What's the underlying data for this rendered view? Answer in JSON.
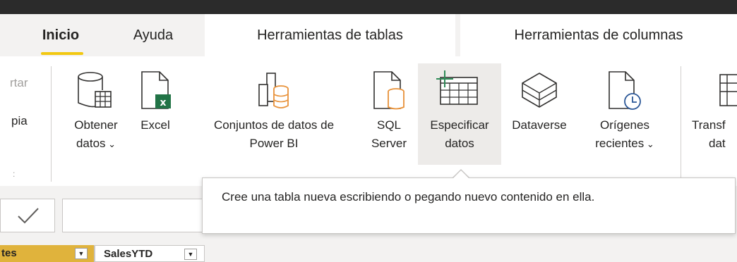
{
  "tabs": {
    "inicio": "Inicio",
    "ayuda": "Ayuda",
    "herramientas_tablas": "Herramientas de tablas",
    "herramientas_columnas": "Herramientas de columnas"
  },
  "ribbon": {
    "left_fragments": {
      "exportar": "rtar",
      "copia": "pia"
    },
    "commands": {
      "obtener_datos": {
        "line1": "Obtener",
        "line2": "datos",
        "has_dropdown": true,
        "icon": "database-table-icon"
      },
      "excel": {
        "line1": "Excel",
        "icon": "excel-file-icon"
      },
      "conjuntos_power_bi": {
        "line1": "Conjuntos de datos de",
        "line2": "Power BI",
        "icon": "power-bi-datasets-icon"
      },
      "sql_server": {
        "line1": "SQL",
        "line2": "Server",
        "icon": "sql-server-icon"
      },
      "especificar_datos": {
        "line1": "Especificar",
        "line2": "datos",
        "icon": "enter-data-icon",
        "hovered": true
      },
      "dataverse": {
        "line1": "Dataverse",
        "icon": "dataverse-icon"
      },
      "origenes_recientes": {
        "line1": "Orígenes",
        "line2": "recientes",
        "has_dropdown": true,
        "icon": "recent-sources-icon"
      },
      "transformar": {
        "line1": "Transf",
        "line2": "dat",
        "icon": "transform-data-icon"
      }
    }
  },
  "tooltip": {
    "text": "Cree una tabla nueva escribiendo o pegando nuevo contenido en ella."
  },
  "formula_bar": {
    "check_icon": "checkmark-icon"
  },
  "columns": [
    {
      "label": "tes"
    },
    {
      "label": "SalesYTD"
    }
  ],
  "colors": {
    "accent_yellow": "#f2c811",
    "excel_green": "#217346",
    "power_bi_orange": "#e8923a",
    "enter_data_green": "#2e8b57",
    "clock_blue": "#2b5797",
    "selected_column": "#e0b33c"
  }
}
